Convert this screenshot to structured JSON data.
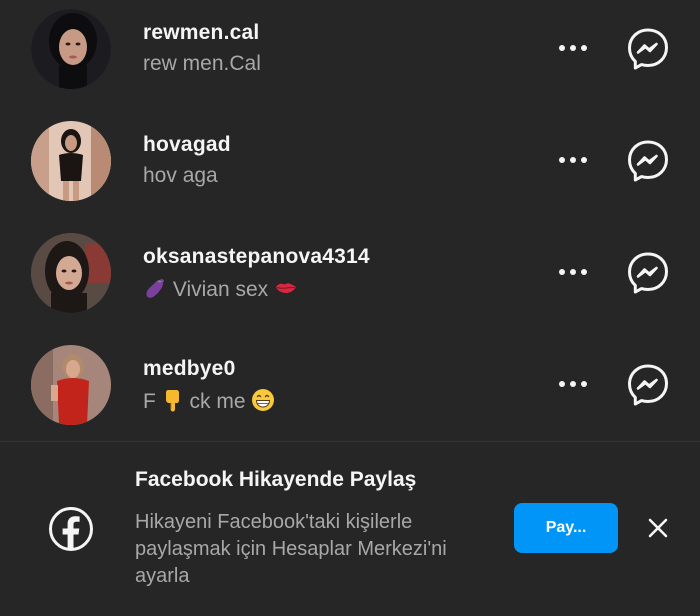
{
  "followers": [
    {
      "username": "rewmen.cal",
      "fullname": "rew men.Cal",
      "avatar_colors": {
        "bg": "#1b1b20",
        "hair": "#0d0d0f",
        "skin": "#c79a86"
      }
    },
    {
      "username": "hovagad",
      "fullname": "hov aga",
      "avatar_colors": {
        "bg": "#d9b8a8",
        "hair": "#1a1412",
        "skin": "#c99a82"
      }
    },
    {
      "username": "oksanastepanova4314",
      "fullname_pre": "Vivian sex",
      "avatar_colors": {
        "bg": "#5a4a44",
        "hair": "#1d1815",
        "skin": "#d4a993"
      }
    },
    {
      "username": "medbye0",
      "fullname_a": "F",
      "fullname_b": "ck me",
      "avatar_colors": {
        "bg": "#a6857a",
        "hair": "#b08a6a",
        "skin": "#d7a88e",
        "dress": "#c2241c"
      }
    }
  ],
  "icons": {
    "more": "more-horizontal-icon",
    "messenger": "messenger-icon",
    "facebook": "facebook-icon",
    "close": "close-icon"
  },
  "fb_share": {
    "title": "Facebook Hikayende Paylaş",
    "description": "Hikayeni Facebook'taki kişilerle paylaşmak için Hesaplar Merkezi'ni ayarla",
    "button_label": "Pay..."
  },
  "colors": {
    "background": "#262626",
    "primary_text": "#f5f5f5",
    "secondary_text": "#a8a8a8",
    "accent": "#0095f6"
  }
}
